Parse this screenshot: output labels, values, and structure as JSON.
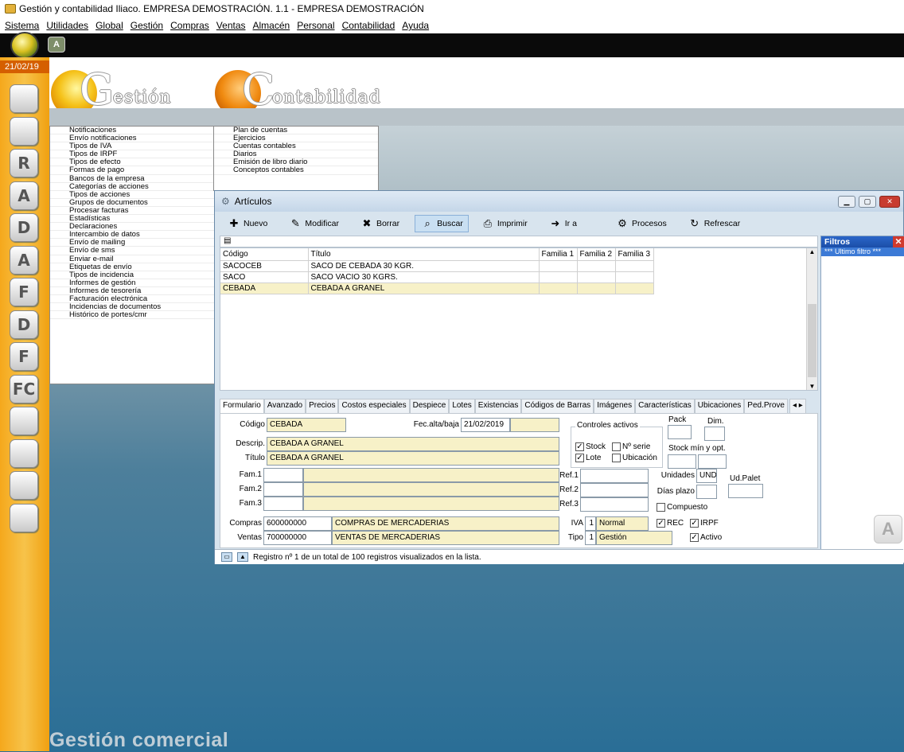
{
  "app": {
    "title": "Gestión y contabilidad Iliaco. EMPRESA DEMOSTRACIÓN. 1.1 - EMPRESA DEMOSTRACIÓN",
    "date": "21/02/19",
    "toolbar_icon2": "A"
  },
  "menubar": [
    "Sistema",
    "Utilidades",
    "Global",
    "Gestión",
    "Compras",
    "Ventas",
    "Almacén",
    "Personal",
    "Contabilidad",
    "Ayuda"
  ],
  "header": {
    "gestion_initial": "G",
    "gestion_rest": "estión",
    "contab_initial": "C",
    "contab_rest": "ontabilidad"
  },
  "leftbar_icons": [
    "users-icon",
    "user-icon",
    "user-r-icon",
    "user-a-icon",
    "doc-d-icon",
    "doc-a-icon",
    "doc-f-icon",
    "doc-d2-icon",
    "doc-f2-icon",
    "doc-fc-icon",
    "bag-icon",
    "bag2-icon",
    "cd-icon",
    "mail-icon"
  ],
  "leftbar_letters": [
    "",
    "",
    "R",
    "A",
    "D",
    "A",
    "F",
    "D",
    "F",
    "FC",
    "",
    "",
    "",
    ""
  ],
  "gestion_menu": [
    "Notificaciones",
    "Envío notificaciones",
    "Tipos de IVA",
    "Tipos de IRPF",
    "Tipos de efecto",
    "Formas de pago",
    "Bancos de la empresa",
    "Categorías de acciones",
    "Tipos de acciones",
    "Grupos de documentos",
    "Procesar facturas",
    "Estadísticas",
    "Declaraciones",
    "Intercambio de datos",
    "Envío de mailing",
    "Envío de sms",
    "Enviar e-mail",
    "Etiquetas de envío",
    "Tipos de incidencia",
    "Informes de gestión",
    "Informes de tesorería",
    "Facturación electrónica",
    "Incidencias de documentos",
    "Histórico de portes/cmr"
  ],
  "contab_menu": [
    "Plan de cuentas",
    "Ejercicios",
    "Cuentas contables",
    "Diarios",
    "Emisión de libro diario",
    "Conceptos contables"
  ],
  "footer_text": "Gestión comercial",
  "articulos": {
    "title": "Artículos",
    "toolbar": [
      {
        "label": "Nuevo",
        "icon": "new-icon",
        "glyph": "✚"
      },
      {
        "label": "Modificar",
        "icon": "edit-icon",
        "glyph": "✎"
      },
      {
        "label": "Borrar",
        "icon": "delete-icon",
        "glyph": "✖"
      },
      {
        "label": "Buscar",
        "icon": "search-icon",
        "glyph": "⌕"
      },
      {
        "label": "Imprimir",
        "icon": "print-icon",
        "glyph": "⎙"
      },
      {
        "label": "Ir a",
        "icon": "goto-icon",
        "glyph": "➜"
      },
      {
        "label": "Procesos",
        "icon": "gear-icon",
        "glyph": "⚙"
      },
      {
        "label": "Refrescar",
        "icon": "refresh-icon",
        "glyph": "↻"
      }
    ],
    "grid": {
      "columns": [
        "Código",
        "Título",
        "Familia 1",
        "Familia 2",
        "Familia 3"
      ],
      "rows": [
        [
          "SACOCEB",
          "SACO DE CEBADA 30 KGR.",
          "",
          "",
          ""
        ],
        [
          "SACO",
          "SACO VACIO 30 KGRS.",
          "",
          "",
          ""
        ],
        [
          "CEBADA",
          "CEBADA A GRANEL",
          "",
          "",
          ""
        ]
      ]
    },
    "filtros": {
      "title": "Filtros",
      "item": "*** Ultimo filtro ***"
    },
    "tabs": [
      "Formulario",
      "Avanzado",
      "Precios",
      "Costos especiales",
      "Despiece",
      "Lotes",
      "Existencias",
      "Códigos de Barras",
      "Imágenes",
      "Características",
      "Ubicaciones",
      "Ped.Prove"
    ],
    "form": {
      "codigo_label": "Código",
      "codigo": "CEBADA",
      "fec_label": "Fec.alta/baja",
      "fec_alta": "21/02/2019",
      "descrip_label": "Descrip.",
      "descrip": "CEBADA A GRANEL",
      "titulo_label": "Título",
      "titulo": "CEBADA A GRANEL",
      "fam1_label": "Fam.1",
      "fam2_label": "Fam.2",
      "fam3_label": "Fam.3",
      "ref1_label": "Ref.1",
      "ref2_label": "Ref.2",
      "ref3_label": "Ref.3",
      "compras_label": "Compras",
      "compras_cta": "600000000",
      "compras_desc": "COMPRAS DE MERCADERIAS",
      "ventas_label": "Ventas",
      "ventas_cta": "700000000",
      "ventas_desc": "VENTAS DE MERCADERIAS",
      "controles_label": "Controles activos",
      "stock_label": "Stock",
      "nserie_label": "Nº serie",
      "lote_label": "Lote",
      "ubicacion_label": "Ubicación",
      "pack_label": "Pack",
      "dim_label": "Dim.",
      "stockminopt_label": "Stock mín y opt.",
      "unidades_label": "Unidades",
      "unidades": "UND",
      "udpalet_label": "Ud.Palet",
      "diasplazo_label": "Días plazo",
      "compuesto_label": "Compuesto",
      "rec_label": "REC",
      "irpf_label": "IRPF",
      "iva_label": "IVA",
      "iva_num": "1",
      "iva_desc": "Normal",
      "tipo_label": "Tipo",
      "tipo_num": "1",
      "tipo_desc": "Gestión",
      "activo_label": "Activo"
    },
    "status": "Registro nº 1 de un total de 100 registros visualizados en la lista."
  },
  "colors": {
    "accent_orange": "#f5a81c",
    "selected_field": "#f7f1c8",
    "filtros_header": "#1b4ea8"
  }
}
